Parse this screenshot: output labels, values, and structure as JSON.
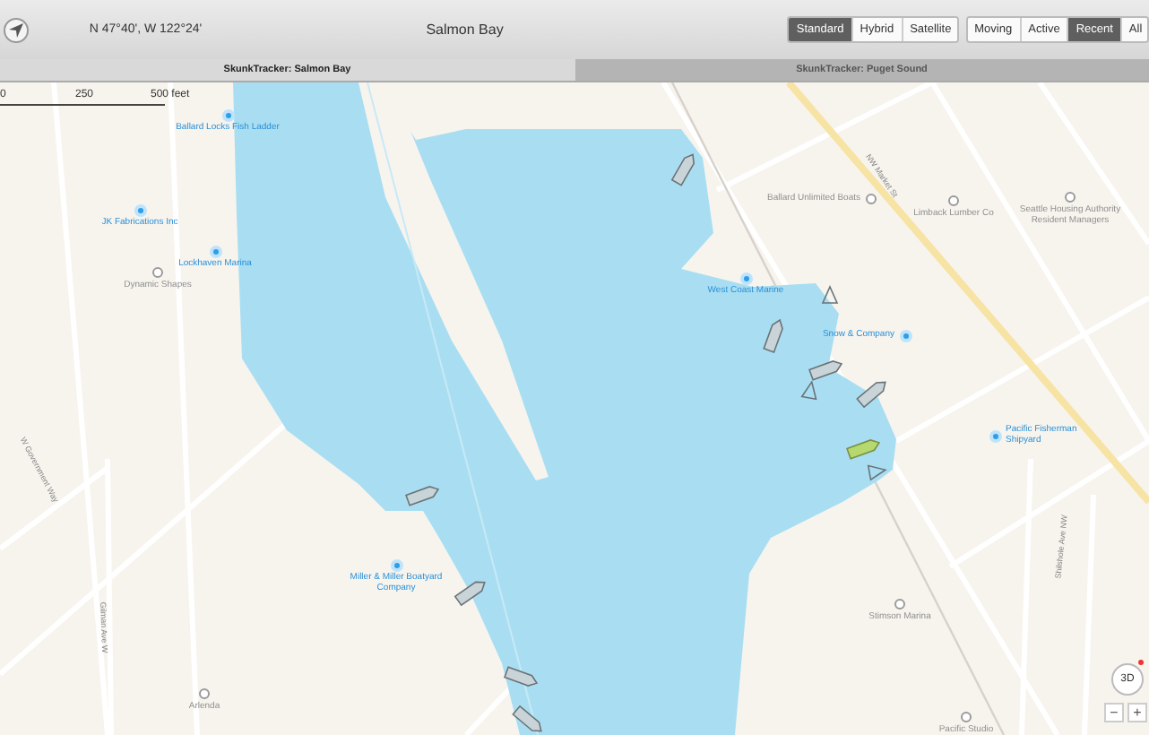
{
  "toolbar": {
    "coordinates": "N 47°40', W 122°24'",
    "title": "Salmon Bay",
    "map_types": [
      {
        "label": "Standard",
        "selected": true
      },
      {
        "label": "Hybrid",
        "selected": false
      },
      {
        "label": "Satellite",
        "selected": false
      }
    ],
    "filters": [
      {
        "label": "Moving",
        "selected": false
      },
      {
        "label": "Active",
        "selected": false
      },
      {
        "label": "Recent",
        "selected": true
      },
      {
        "label": "All",
        "selected": false
      }
    ]
  },
  "tabs": [
    {
      "label": "SkunkTracker: Salmon Bay",
      "selected": true
    },
    {
      "label": "SkunkTracker: Puget Sound",
      "selected": false
    }
  ],
  "map": {
    "scale": [
      "0",
      "250",
      "500 feet"
    ],
    "places": [
      {
        "name": "Ballard Locks Fish Ladder",
        "kind": "business"
      },
      {
        "name": "JK Fabrications Inc",
        "kind": "business"
      },
      {
        "name": "Lockhaven Marina",
        "kind": "business"
      },
      {
        "name": "Dynamic Shapes",
        "kind": "place"
      },
      {
        "name": "West Coast Marine",
        "kind": "business"
      },
      {
        "name": "Snow & Company",
        "kind": "business"
      },
      {
        "name": "Pacific Fisherman Shipyard",
        "kind": "business"
      },
      {
        "name": "Miller & Miller Boatyard Company",
        "kind": "business"
      },
      {
        "name": "Ballard Unlimited Boats",
        "kind": "place"
      },
      {
        "name": "Limback Lumber Co",
        "kind": "place"
      },
      {
        "name": "Seattle Housing Authority Resident Managers",
        "kind": "place"
      },
      {
        "name": "Stimson Marina",
        "kind": "place"
      },
      {
        "name": "Arlenda",
        "kind": "place"
      },
      {
        "name": "Pacific Studio",
        "kind": "place"
      }
    ],
    "streets": [
      "NW Market St",
      "Shilshole Ave NW",
      "Gilman Ave W",
      "W Government Way"
    ],
    "vessels": [
      {
        "kind": "motor",
        "selected": false
      },
      {
        "kind": "sail",
        "selected": false
      },
      {
        "kind": "motor",
        "selected": false
      },
      {
        "kind": "motor",
        "selected": false
      },
      {
        "kind": "sail",
        "selected": false
      },
      {
        "kind": "motor",
        "selected": false
      },
      {
        "kind": "motor",
        "selected": true
      },
      {
        "kind": "sail",
        "selected": false
      },
      {
        "kind": "motor",
        "selected": false
      },
      {
        "kind": "motor",
        "selected": false
      },
      {
        "kind": "motor",
        "selected": false
      },
      {
        "kind": "motor",
        "selected": false
      }
    ],
    "controls": {
      "view_3d": "3D",
      "zoom_out": "−",
      "zoom_in": "+"
    }
  }
}
